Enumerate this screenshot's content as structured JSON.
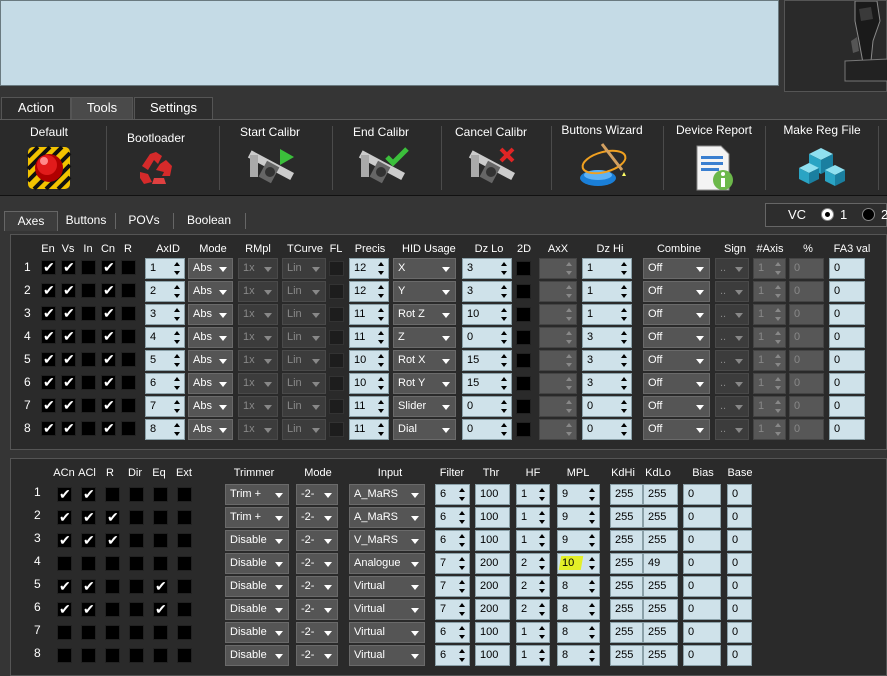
{
  "main_tabs": [
    {
      "label": "Action",
      "active": false
    },
    {
      "label": "Tools",
      "active": true
    },
    {
      "label": "Settings",
      "active": false
    }
  ],
  "tools": [
    {
      "label": "Default",
      "icon": "stop-button-icon"
    },
    {
      "label": "Bootloader",
      "icon": "recycle-icon"
    },
    {
      "label": "Start Calibr",
      "icon": "caliper-play-icon"
    },
    {
      "label": "End Calibr",
      "icon": "caliper-check-icon"
    },
    {
      "label": "Cancel Calibr",
      "icon": "caliper-x-icon"
    },
    {
      "label": "Buttons Wizard",
      "icon": "wizard-icon"
    },
    {
      "label": "Device Report",
      "icon": "document-info-icon"
    },
    {
      "label": "Make Reg File",
      "icon": "registry-cubes-icon"
    }
  ],
  "sub_tabs": [
    {
      "label": "Axes",
      "active": true
    },
    {
      "label": "Buttons",
      "active": false
    },
    {
      "label": "POVs",
      "active": false
    },
    {
      "label": "Boolean",
      "active": false
    }
  ],
  "vc": {
    "label": "VC",
    "options": [
      {
        "label": "1",
        "selected": true
      },
      {
        "label": "2",
        "selected": false
      }
    ]
  },
  "axes_headers": [
    "En",
    "Vs",
    "In",
    "Cn",
    "R",
    "AxID",
    "Mode",
    "RMpl",
    "TCurve",
    "FL",
    "Precis",
    "HID Usage",
    "Dz Lo",
    "2D",
    "AxX",
    "Dz Hi",
    "Combine",
    "Sign",
    "#Axis",
    "%",
    "FA3 val"
  ],
  "axes_rows": [
    {
      "n": "1",
      "en": true,
      "vs": true,
      "in": false,
      "cn": true,
      "r": false,
      "axid": "1",
      "mode": "Abs",
      "rmpl": "1x",
      "tcurve": "Lin",
      "precis": "12",
      "hid": "X",
      "dzlo": "3",
      "dzhi": "1",
      "combine": "Off",
      "sign": "..",
      "axis": "1",
      "pct": "0",
      "fa3": "0"
    },
    {
      "n": "2",
      "en": true,
      "vs": true,
      "in": false,
      "cn": true,
      "r": false,
      "axid": "2",
      "mode": "Abs",
      "rmpl": "1x",
      "tcurve": "Lin",
      "precis": "12",
      "hid": "Y",
      "dzlo": "3",
      "dzhi": "1",
      "combine": "Off",
      "sign": "..",
      "axis": "1",
      "pct": "0",
      "fa3": "0"
    },
    {
      "n": "3",
      "en": true,
      "vs": true,
      "in": false,
      "cn": true,
      "r": false,
      "axid": "3",
      "mode": "Abs",
      "rmpl": "1x",
      "tcurve": "Lin",
      "precis": "11",
      "hid": "Rot Z",
      "dzlo": "10",
      "dzhi": "1",
      "combine": "Off",
      "sign": "..",
      "axis": "1",
      "pct": "0",
      "fa3": "0"
    },
    {
      "n": "4",
      "en": true,
      "vs": true,
      "in": false,
      "cn": true,
      "r": false,
      "axid": "4",
      "mode": "Abs",
      "rmpl": "1x",
      "tcurve": "Lin",
      "precis": "11",
      "hid": "Z",
      "dzlo": "0",
      "dzhi": "3",
      "combine": "Off",
      "sign": "..",
      "axis": "1",
      "pct": "0",
      "fa3": "0"
    },
    {
      "n": "5",
      "en": true,
      "vs": true,
      "in": false,
      "cn": true,
      "r": false,
      "axid": "5",
      "mode": "Abs",
      "rmpl": "1x",
      "tcurve": "Lin",
      "precis": "10",
      "hid": "Rot X",
      "dzlo": "15",
      "dzhi": "3",
      "combine": "Off",
      "sign": "..",
      "axis": "1",
      "pct": "0",
      "fa3": "0"
    },
    {
      "n": "6",
      "en": true,
      "vs": true,
      "in": false,
      "cn": true,
      "r": false,
      "axid": "6",
      "mode": "Abs",
      "rmpl": "1x",
      "tcurve": "Lin",
      "precis": "10",
      "hid": "Rot Y",
      "dzlo": "15",
      "dzhi": "3",
      "combine": "Off",
      "sign": "..",
      "axis": "1",
      "pct": "0",
      "fa3": "0"
    },
    {
      "n": "7",
      "en": true,
      "vs": true,
      "in": false,
      "cn": true,
      "r": false,
      "axid": "7",
      "mode": "Abs",
      "rmpl": "1x",
      "tcurve": "Lin",
      "precis": "11",
      "hid": "Slider",
      "dzlo": "0",
      "dzhi": "0",
      "combine": "Off",
      "sign": "..",
      "axis": "1",
      "pct": "0",
      "fa3": "0"
    },
    {
      "n": "8",
      "en": true,
      "vs": true,
      "in": false,
      "cn": true,
      "r": false,
      "axid": "8",
      "mode": "Abs",
      "rmpl": "1x",
      "tcurve": "Lin",
      "precis": "11",
      "hid": "Dial",
      "dzlo": "0",
      "dzhi": "0",
      "combine": "Off",
      "sign": "..",
      "axis": "1",
      "pct": "0",
      "fa3": "0"
    }
  ],
  "filter_headers": [
    "ACn",
    "ACl",
    "R",
    "Dir",
    "Eq",
    "Ext",
    "Trimmer",
    "Mode",
    "Input",
    "Filter",
    "Thr",
    "HF",
    "MPL",
    "KdHi",
    "KdLo",
    "Bias",
    "Base"
  ],
  "filter_rows": [
    {
      "n": "1",
      "acn": true,
      "acl": true,
      "r": false,
      "dir": false,
      "eq": false,
      "ext": false,
      "trimmer": "Trim +",
      "mode": "-2-",
      "input": "A_MaRS",
      "filter": "6",
      "thr": "100",
      "hf": "1",
      "mpl": "9",
      "kdhi": "255",
      "kdlo": "255",
      "bias": "0",
      "base": "0"
    },
    {
      "n": "2",
      "acn": true,
      "acl": true,
      "r": true,
      "dir": false,
      "eq": false,
      "ext": false,
      "trimmer": "Trim +",
      "mode": "-2-",
      "input": "A_MaRS",
      "filter": "6",
      "thr": "100",
      "hf": "1",
      "mpl": "9",
      "kdhi": "255",
      "kdlo": "255",
      "bias": "0",
      "base": "0"
    },
    {
      "n": "3",
      "acn": true,
      "acl": true,
      "r": true,
      "dir": false,
      "eq": false,
      "ext": false,
      "trimmer": "Disable",
      "mode": "-2-",
      "input": "V_MaRS",
      "filter": "6",
      "thr": "100",
      "hf": "1",
      "mpl": "9",
      "kdhi": "255",
      "kdlo": "255",
      "bias": "0",
      "base": "0"
    },
    {
      "n": "4",
      "acn": false,
      "acl": false,
      "r": false,
      "dir": false,
      "eq": false,
      "ext": false,
      "trimmer": "Disable",
      "mode": "-2-",
      "input": "Analogue",
      "filter": "7",
      "thr": "200",
      "hf": "2",
      "mpl": "10",
      "kdhi": "255",
      "kdlo": "49",
      "bias": "0",
      "base": "0"
    },
    {
      "n": "5",
      "acn": true,
      "acl": true,
      "r": false,
      "dir": false,
      "eq": true,
      "ext": false,
      "trimmer": "Disable",
      "mode": "-2-",
      "input": "Virtual",
      "filter": "7",
      "thr": "200",
      "hf": "2",
      "mpl": "8",
      "kdhi": "255",
      "kdlo": "255",
      "bias": "0",
      "base": "0"
    },
    {
      "n": "6",
      "acn": true,
      "acl": true,
      "r": false,
      "dir": false,
      "eq": true,
      "ext": false,
      "trimmer": "Disable",
      "mode": "-2-",
      "input": "Virtual",
      "filter": "7",
      "thr": "200",
      "hf": "2",
      "mpl": "8",
      "kdhi": "255",
      "kdlo": "255",
      "bias": "0",
      "base": "0"
    },
    {
      "n": "7",
      "acn": false,
      "acl": false,
      "r": false,
      "dir": false,
      "eq": false,
      "ext": false,
      "trimmer": "Disable",
      "mode": "-2-",
      "input": "Virtual",
      "filter": "6",
      "thr": "100",
      "hf": "1",
      "mpl": "8",
      "kdhi": "255",
      "kdlo": "255",
      "bias": "0",
      "base": "0"
    },
    {
      "n": "8",
      "acn": false,
      "acl": false,
      "r": false,
      "dir": false,
      "eq": false,
      "ext": false,
      "trimmer": "Disable",
      "mode": "-2-",
      "input": "Virtual",
      "filter": "6",
      "thr": "100",
      "hf": "1",
      "mpl": "8",
      "kdhi": "255",
      "kdlo": "255",
      "bias": "0",
      "base": "0"
    }
  ]
}
